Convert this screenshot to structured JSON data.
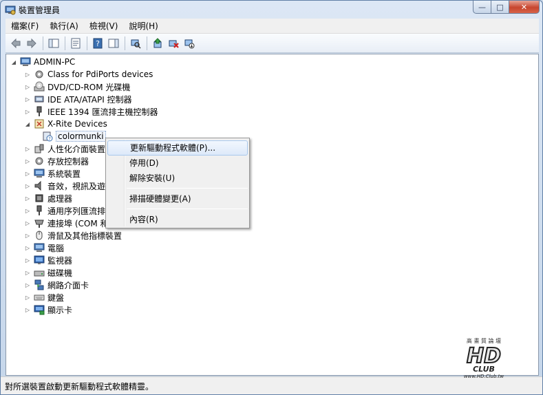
{
  "window": {
    "title": "裝置管理員",
    "controls": {
      "minimize": "—",
      "maximize": "□",
      "close": "✕"
    }
  },
  "menu": {
    "items": [
      "檔案(F)",
      "執行(A)",
      "檢視(V)",
      "說明(H)"
    ]
  },
  "tree": {
    "root": "ADMIN-PC",
    "nodes": [
      {
        "label": "Class for PdiPorts devices",
        "icon": "gear-icon"
      },
      {
        "label": "DVD/CD-ROM 光碟機",
        "icon": "disc-drive-icon"
      },
      {
        "label": "IDE ATA/ATAPI 控制器",
        "icon": "ide-controller-icon"
      },
      {
        "label": "IEEE 1394 匯流排主機控制器",
        "icon": "firewire-icon"
      },
      {
        "label": "X-Rite Devices",
        "icon": "xrite-device-icon",
        "expanded": true,
        "children": [
          {
            "label": "colormunki",
            "icon": "unknown-device-icon"
          }
        ]
      },
      {
        "label": "人性化介面裝置",
        "icon": "hid-icon"
      },
      {
        "label": "存放控制器",
        "icon": "storage-controller-icon"
      },
      {
        "label": "系統裝置",
        "icon": "system-device-icon"
      },
      {
        "label": "音效，視訊及遊",
        "icon": "audio-icon"
      },
      {
        "label": "處理器",
        "icon": "processor-icon"
      },
      {
        "label": "通用序列匯流排",
        "icon": "usb-icon"
      },
      {
        "label": "連接埠 (COM 和",
        "icon": "port-icon"
      },
      {
        "label": "滑鼠及其他指標裝置",
        "icon": "mouse-icon"
      },
      {
        "label": "電腦",
        "icon": "computer-icon"
      },
      {
        "label": "監視器",
        "icon": "monitor-icon"
      },
      {
        "label": "磁碟機",
        "icon": "disk-drive-icon"
      },
      {
        "label": "網路介面卡",
        "icon": "network-adapter-icon"
      },
      {
        "label": "鍵盤",
        "icon": "keyboard-icon"
      },
      {
        "label": "顯示卡",
        "icon": "display-adapter-icon"
      }
    ]
  },
  "context_menu": {
    "items": [
      "更新驅動程式軟體(P)...",
      "停用(D)",
      "解除安裝(U)",
      "掃描硬體變更(A)",
      "內容(R)"
    ]
  },
  "status": {
    "text": "對所選裝置啟動更新驅動程式軟體精靈。"
  },
  "watermark": {
    "top_text": "高 畫 質 論 壇",
    "logo_text": "HD",
    "club_text": "CLUB",
    "url": "www.HD.Club.tw"
  },
  "colors": {
    "accent": "#3a6fb0",
    "selection_border": "#a8c8ec",
    "tree_background": "#ffffff"
  }
}
